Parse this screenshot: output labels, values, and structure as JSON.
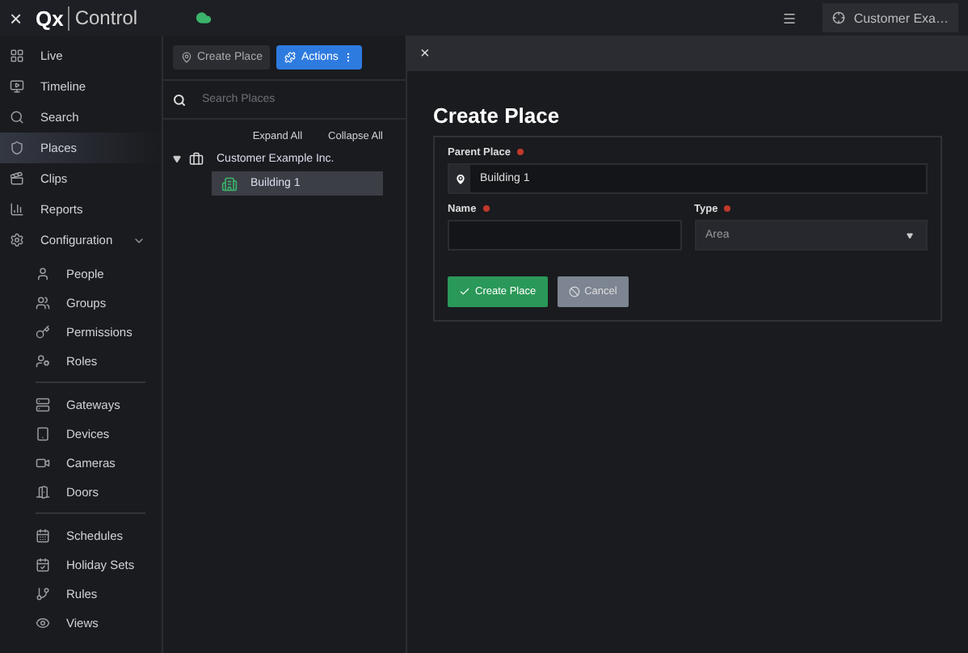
{
  "topbar": {
    "close": "×",
    "logo_mark": "Qx",
    "logo_text": "Control",
    "account": "Customer Exa…"
  },
  "sidebar": {
    "items": [
      {
        "label": "Live",
        "selected": false
      },
      {
        "label": "Timeline",
        "selected": false
      },
      {
        "label": "Search",
        "selected": false
      },
      {
        "label": "Places",
        "selected": true
      },
      {
        "label": "Clips",
        "selected": false
      },
      {
        "label": "Reports",
        "selected": false
      }
    ],
    "configuration": {
      "label": "Configuration",
      "expanded": true,
      "sections": [
        [
          {
            "label": "People",
            "selected": false
          },
          {
            "label": "Groups",
            "selected": false
          },
          {
            "label": "Permissions",
            "selected": false
          },
          {
            "label": "Roles",
            "selected": false
          }
        ],
        [
          {
            "label": "Gateways",
            "selected": false
          },
          {
            "label": "Devices",
            "selected": false
          },
          {
            "label": "Cameras",
            "selected": false
          },
          {
            "label": "Doors",
            "selected": false
          }
        ],
        [
          {
            "label": "Schedules",
            "selected": false
          },
          {
            "label": "Holiday Sets",
            "selected": false
          },
          {
            "label": "Rules",
            "selected": false
          },
          {
            "label": "Views",
            "selected": false
          }
        ]
      ]
    }
  },
  "places_panel": {
    "toolbar": [
      {
        "label": "Create Place",
        "kind": "secondary"
      },
      {
        "label": "Actions",
        "kind": "primary"
      }
    ],
    "search": {
      "placeholder": "Search Places"
    },
    "links": [
      "Expand All",
      "Collapse All"
    ],
    "tree": [
      {
        "label": "Customer Example Inc.",
        "expanded": true,
        "selected": false,
        "children": [
          {
            "label": "Building 1",
            "selected": true
          }
        ]
      }
    ]
  },
  "dialog": {
    "close": "×",
    "title": "Create Place",
    "fields": [
      {
        "label": "Parent Place",
        "required": true,
        "kind": "picker",
        "value": "Building 1"
      },
      {
        "label": "Name",
        "required": true,
        "kind": "text"
      },
      {
        "label": "Type",
        "required": true,
        "kind": "select",
        "value": "Area"
      }
    ],
    "buttons": [
      {
        "label": "Create Place",
        "kind": "primary",
        "disabled": false
      },
      {
        "label": "Cancel",
        "kind": "secondary",
        "disabled": true
      }
    ]
  }
}
